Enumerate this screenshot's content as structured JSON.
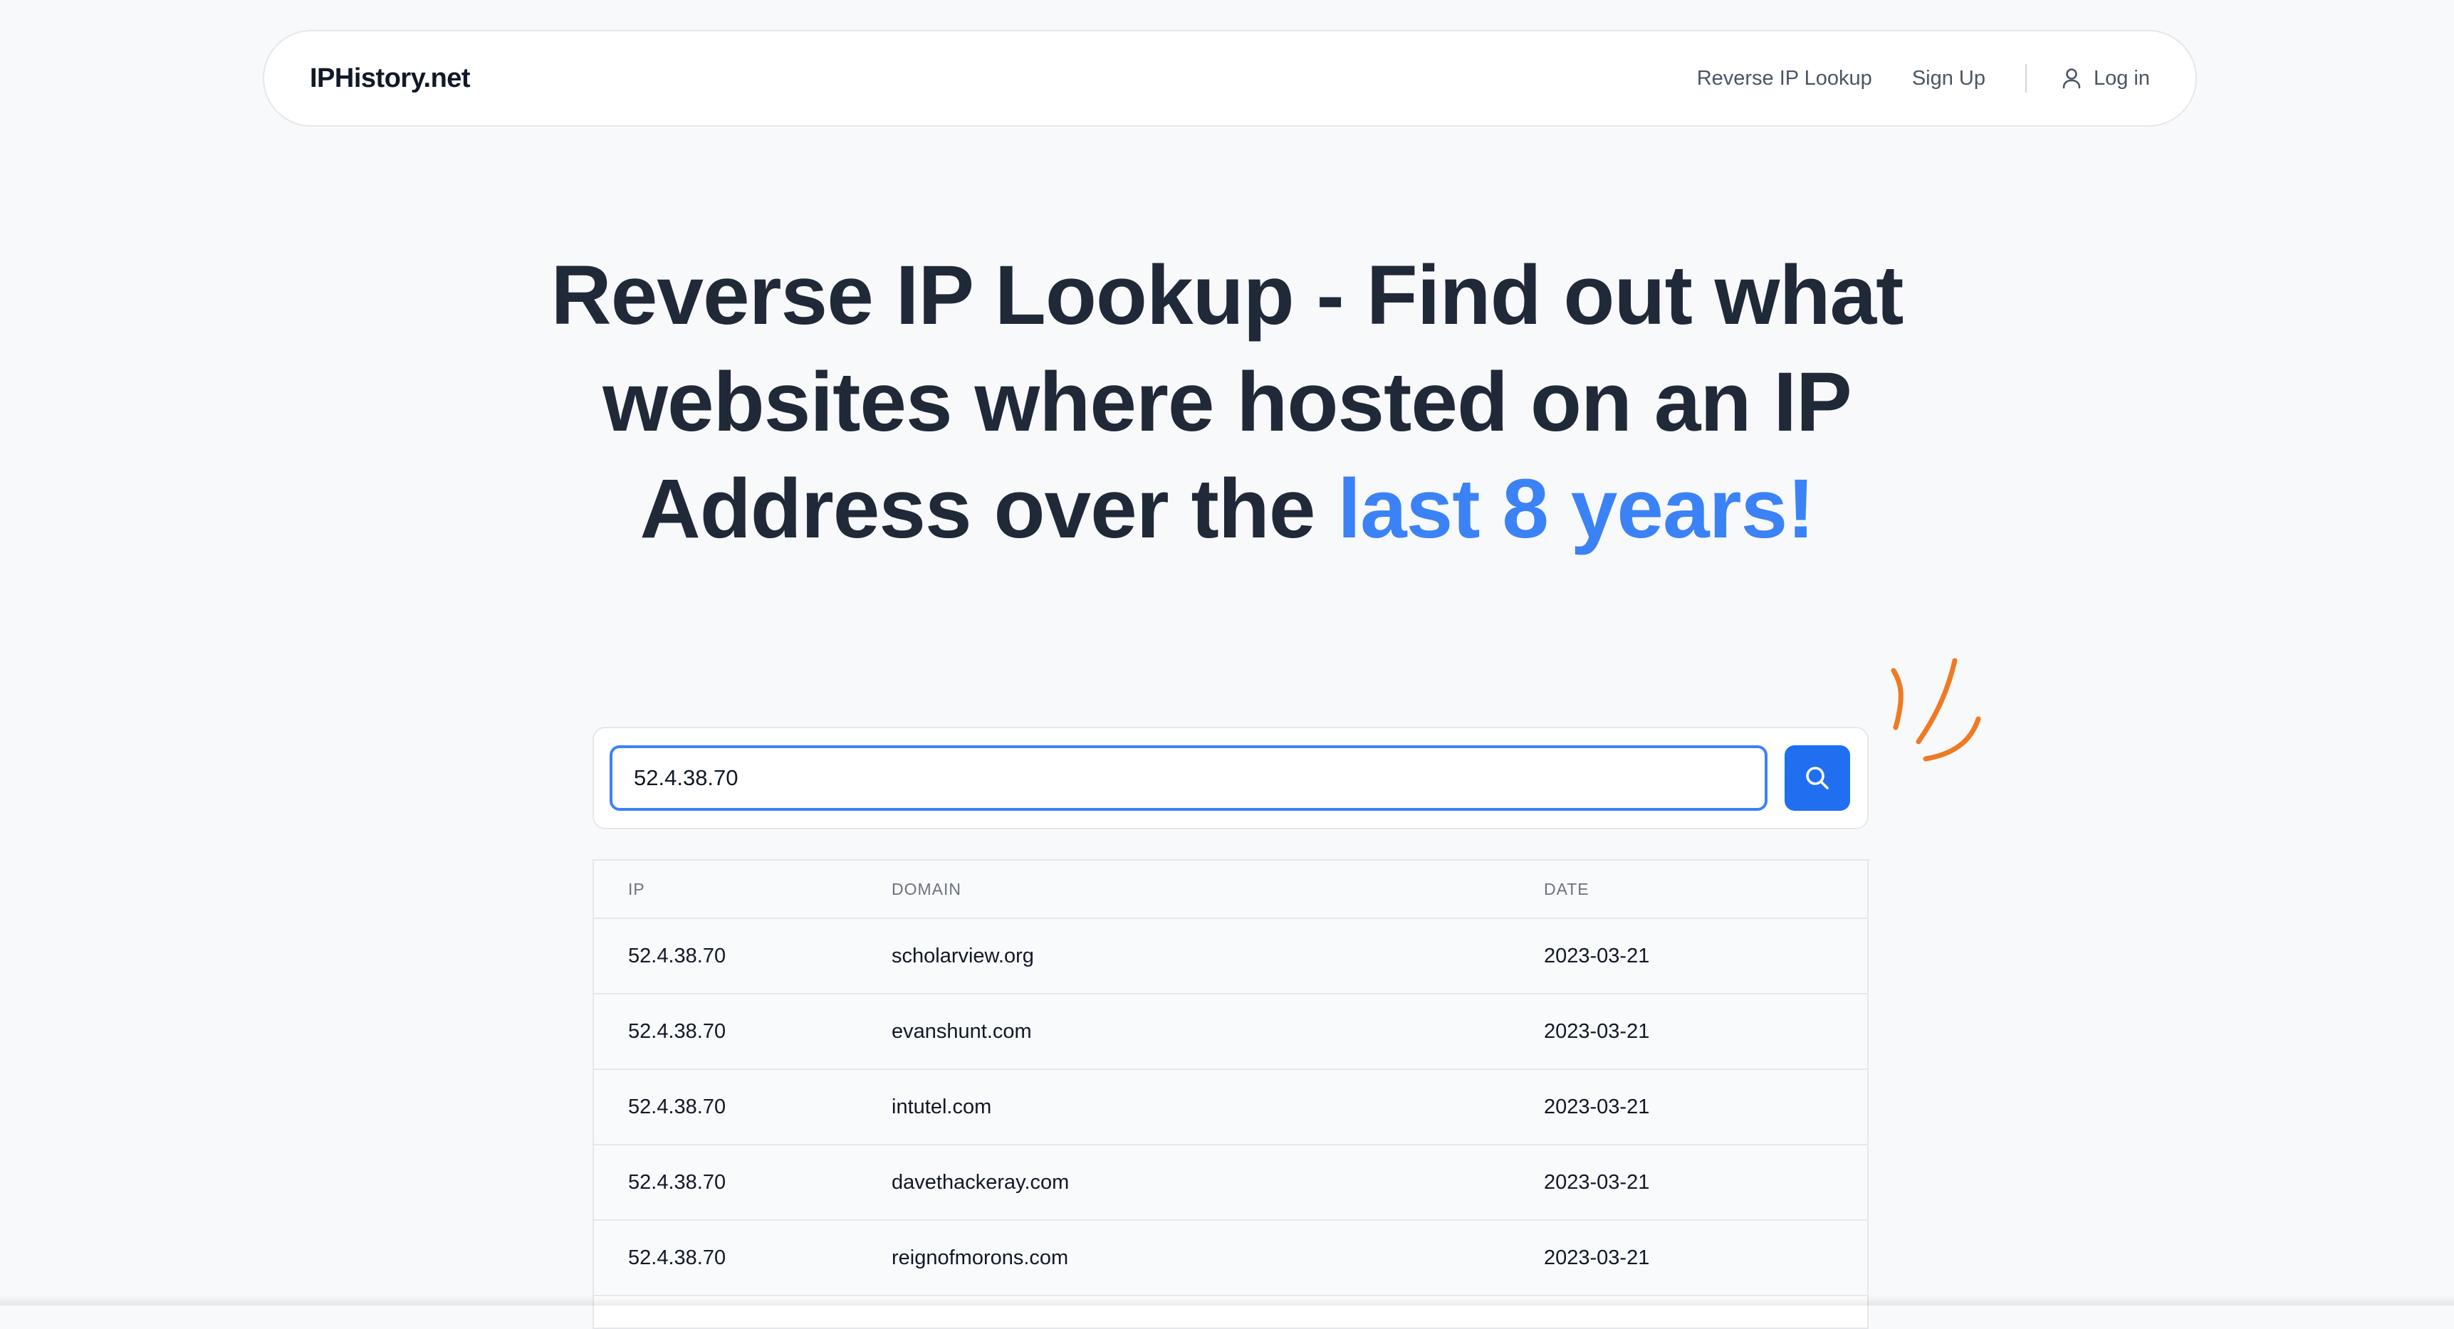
{
  "header": {
    "brand": "IPHistory.net",
    "nav": {
      "reverse_ip_lookup": "Reverse IP Lookup",
      "sign_up": "Sign Up",
      "log_in": "Log in"
    }
  },
  "hero": {
    "title_main": "Reverse IP Lookup - Find out what websites where hosted on an IP Address over the ",
    "title_accent": "last 8 years!"
  },
  "search": {
    "value": "52.4.38.70",
    "button_icon": "search-icon"
  },
  "table": {
    "columns": {
      "ip": "IP",
      "domain": "DOMAIN",
      "date": "DATE"
    },
    "rows": [
      {
        "ip": "52.4.38.70",
        "domain": "scholarview.org",
        "date": "2023-03-21"
      },
      {
        "ip": "52.4.38.70",
        "domain": "evanshunt.com",
        "date": "2023-03-21"
      },
      {
        "ip": "52.4.38.70",
        "domain": "intutel.com",
        "date": "2023-03-21"
      },
      {
        "ip": "52.4.38.70",
        "domain": "davethackeray.com",
        "date": "2023-03-21"
      },
      {
        "ip": "52.4.38.70",
        "domain": "reignofmorons.com",
        "date": "2023-03-21"
      }
    ]
  },
  "colors": {
    "accent": "#3b82f6",
    "button": "#1f6ff0",
    "squiggle": "#f07a23",
    "text_dark": "#1f2937",
    "background": "#f8f9fb"
  }
}
